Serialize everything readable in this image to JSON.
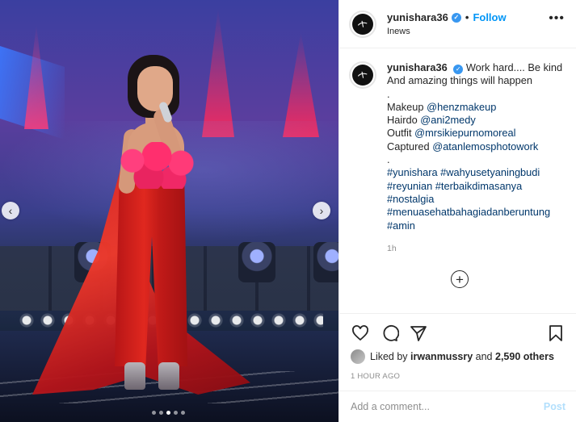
{
  "media": {
    "carousel": {
      "prev_icon": "chevron-left-icon",
      "next_icon": "chevron-right-icon",
      "prev_glyph": "‹",
      "next_glyph": "›",
      "slide_count": 5,
      "active_index": 2
    }
  },
  "header": {
    "username": "yunishara36",
    "separator": "•",
    "follow_label": "Follow",
    "location": "Inews",
    "more_glyph": "•••"
  },
  "caption": {
    "username": "yunishara36",
    "lines": [
      "Work hard.... Be kind",
      "And amazing things will happen",
      ".",
      "Makeup ",
      "Hairdo ",
      "Outfit ",
      "Captured ",
      "."
    ],
    "mentions": {
      "makeup": "@henzmakeup",
      "hairdo": "@ani2medy",
      "outfit": "@mrsikiepurnomoreal",
      "captured": "@atanlemosphotowork"
    },
    "hashtags": [
      "#yunishara",
      "#wahyusetyaningbudi",
      "#reyunian",
      "#terbaikdimasanya",
      "#nostalgia",
      "#menuasehatbahagiadanberuntung",
      "#amin"
    ],
    "time": "1h"
  },
  "add_comment_glyph": "+",
  "likes": {
    "prefix": "Liked by ",
    "user": "irwanmussry",
    "middle": " and ",
    "count": "2,590 others"
  },
  "timestamp": "1 HOUR AGO",
  "comment": {
    "placeholder": "Add a comment...",
    "post_label": "Post"
  },
  "colors": {
    "accent": "#0095f6",
    "link": "#00376b",
    "verified": "#3897f0"
  }
}
